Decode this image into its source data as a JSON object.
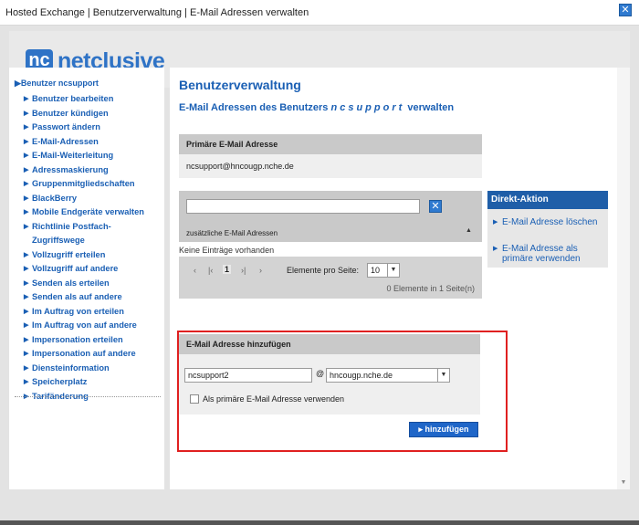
{
  "window": {
    "title": "Hosted Exchange | Benutzerverwaltung | E-Mail Adressen verwalten",
    "close_glyph": "✕"
  },
  "brand": {
    "logo_mark": "nc",
    "logo_text": "netclusive",
    "color": "#2f73c6"
  },
  "sidebar": {
    "head": "Benutzer ncsupport",
    "items": [
      "Benutzer bearbeiten",
      "Benutzer kündigen",
      "Passwort ändern",
      "E-Mail-Adressen",
      "E-Mail-Weiterleitung",
      "Adressmaskierung",
      "Gruppenmitgliedschaften",
      "BlackBerry",
      "Mobile Endgeräte verwalten",
      "Richtlinie Postfach-Zugriffswege",
      "Vollzugriff erteilen",
      "Vollzugriff auf andere",
      "Senden als erteilen",
      "Senden als auf andere",
      "Im Auftrag von erteilen",
      "Im Auftrag von auf andere",
      "Impersonation erteilen",
      "Impersonation auf andere",
      "Diensteinformation",
      "Speicherplatz",
      "Tarifänderung"
    ]
  },
  "main": {
    "title": "Benutzerverwaltung",
    "subtitle_prefix": "E-Mail Adressen des Benutzers",
    "subtitle_user": "ncsupport",
    "subtitle_suffix": "verwalten",
    "primary": {
      "label": "Primäre E-Mail Adresse",
      "value": "ncsupport@hncougp.nche.de"
    },
    "additional": {
      "filter_value": "",
      "label": "zusätzliche E-Mail Adressen",
      "empty": "Keine Einträge vorhanden",
      "pager_current": "1",
      "per_page_label": "Elemente pro Seite:",
      "per_page_value": "10",
      "summary": "0 Elemente in 1 Seite(n)"
    },
    "add": {
      "header": "E-Mail Adresse hinzufügen",
      "local_part": "ncsupport2",
      "at": "@",
      "domain": "hncougp.nche.de",
      "primary_checkbox_label": "Als primäre E-Mail Adresse verwenden",
      "primary_checked": false,
      "button": "hinzufügen"
    }
  },
  "direkt": {
    "head": "Direkt-Aktion",
    "items": [
      "E-Mail Adresse löschen",
      "E-Mail Adresse als primäre verwenden"
    ]
  },
  "colors": {
    "link": "#1a5fb4",
    "accent": "#1f5ea8",
    "highlight": "#e02020"
  }
}
